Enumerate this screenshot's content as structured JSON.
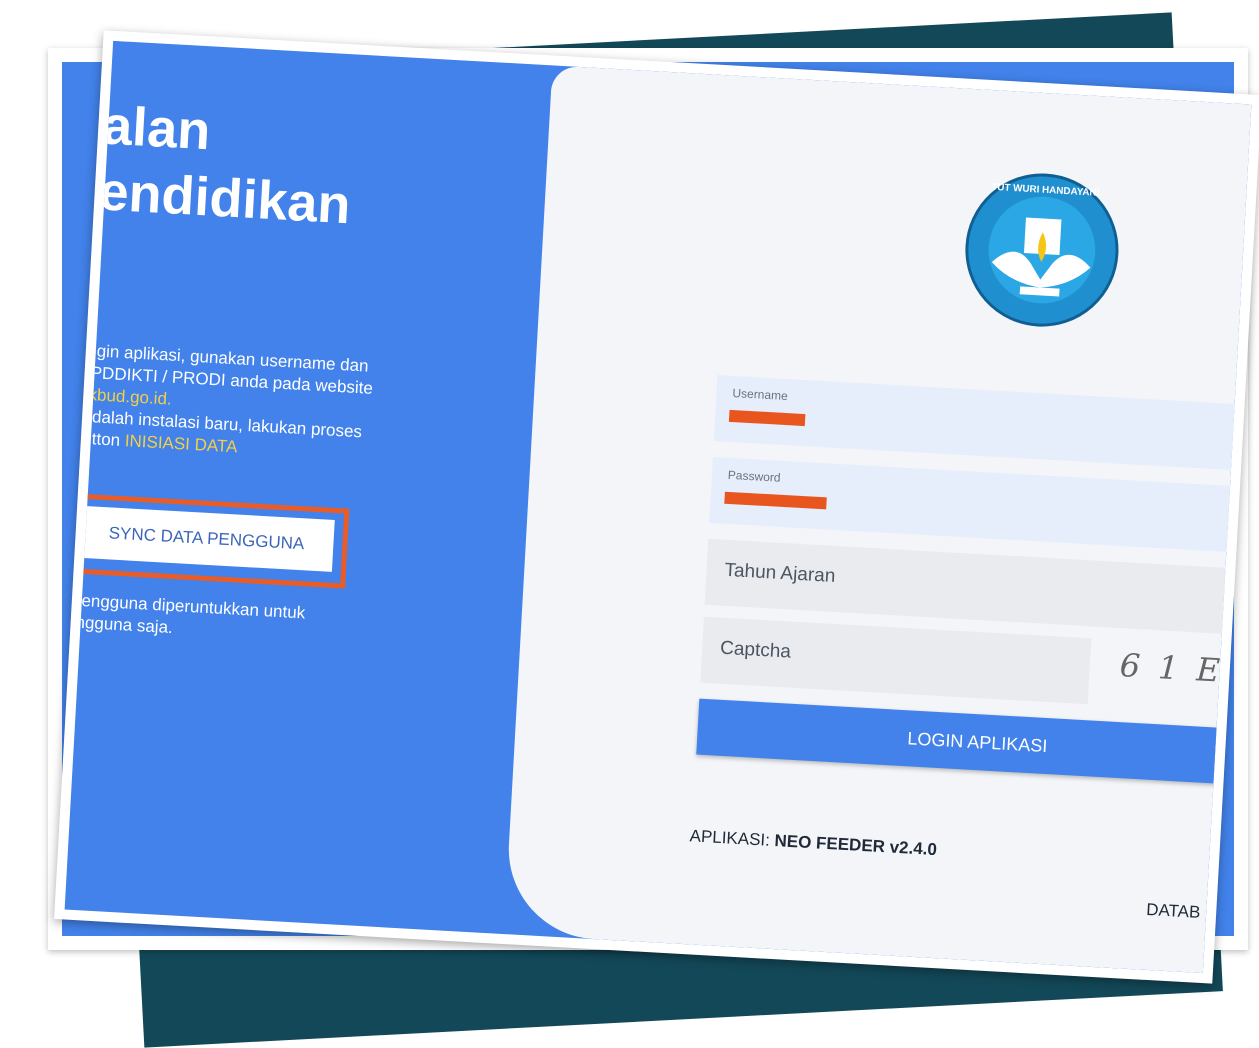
{
  "left": {
    "title_line1": "alan",
    "title_line2": "endidikan",
    "info_line1": "Login aplikasi, gunakan username dan",
    "info_line2_prefix": "e PDDIKTI / PRODI anda pada website",
    "info_line3_link": "dikbud.go.id.",
    "info_line4": "i adalah instalasi baru, lakukan proses",
    "info_line5_prefix": "button ",
    "info_line5_link": "INISIASI DATA",
    "sync_button": "SYNC DATA PENGGUNA",
    "sync_note_line1": "a pengguna diperuntukkan untuk",
    "sync_note_line2": "pengguna saja."
  },
  "form": {
    "logo_text": "TUT WURI HANDAYANI",
    "username_label": "Username",
    "password_label": "Password",
    "tahun_ajaran_placeholder": "Tahun Ajaran",
    "captcha_placeholder": "Captcha",
    "captcha_text": "61E",
    "login_button": "LOGIN APLIKASI"
  },
  "footer": {
    "app_prefix": "APLIKASI: ",
    "app_name": "NEO FEEDER v2.4.0",
    "db_label": "DATAB"
  },
  "colors": {
    "primary_blue": "#4282ea",
    "highlight_orange": "#e85d27",
    "link_yellow": "#f2d046",
    "dark_teal": "#134858"
  }
}
